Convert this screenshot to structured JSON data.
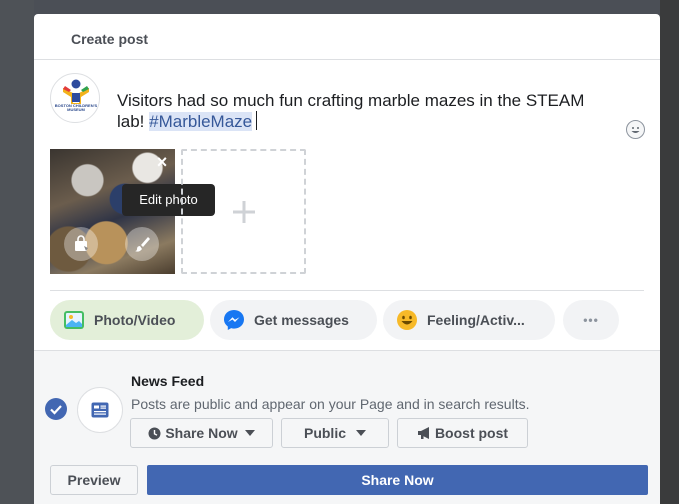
{
  "dialog": {
    "title": "Create post",
    "composer": {
      "text_before": "Visitors had so much fun crafting marble mazes in the STEAM lab! ",
      "hashtag": "#MarbleMaze",
      "avatar_caption": "BOSTON CHILDREN'S MUSEUM"
    },
    "photo": {
      "close_label": "×",
      "tooltip": "Edit photo"
    },
    "add_photo_label": "+",
    "actions": [
      {
        "label": "Photo/Video",
        "icon": "photo-icon"
      },
      {
        "label": "Get messages",
        "icon": "messenger-icon"
      },
      {
        "label": "Feeling/Activ...",
        "icon": "smiley-icon"
      },
      {
        "label": "•••",
        "icon": "more-icon"
      }
    ],
    "audience": {
      "title": "News Feed",
      "description": "Posts are public and appear on your Page and in search results.",
      "share_now_label": "Share Now",
      "public_label": "Public",
      "boost_label": "Boost post"
    },
    "footer": {
      "preview_label": "Preview",
      "submit_label": "Share Now"
    },
    "colors": {
      "primary": "#4267b2",
      "photo_pill_bg": "#e3efd9",
      "hashtag_bg": "#dbe4f6"
    }
  }
}
